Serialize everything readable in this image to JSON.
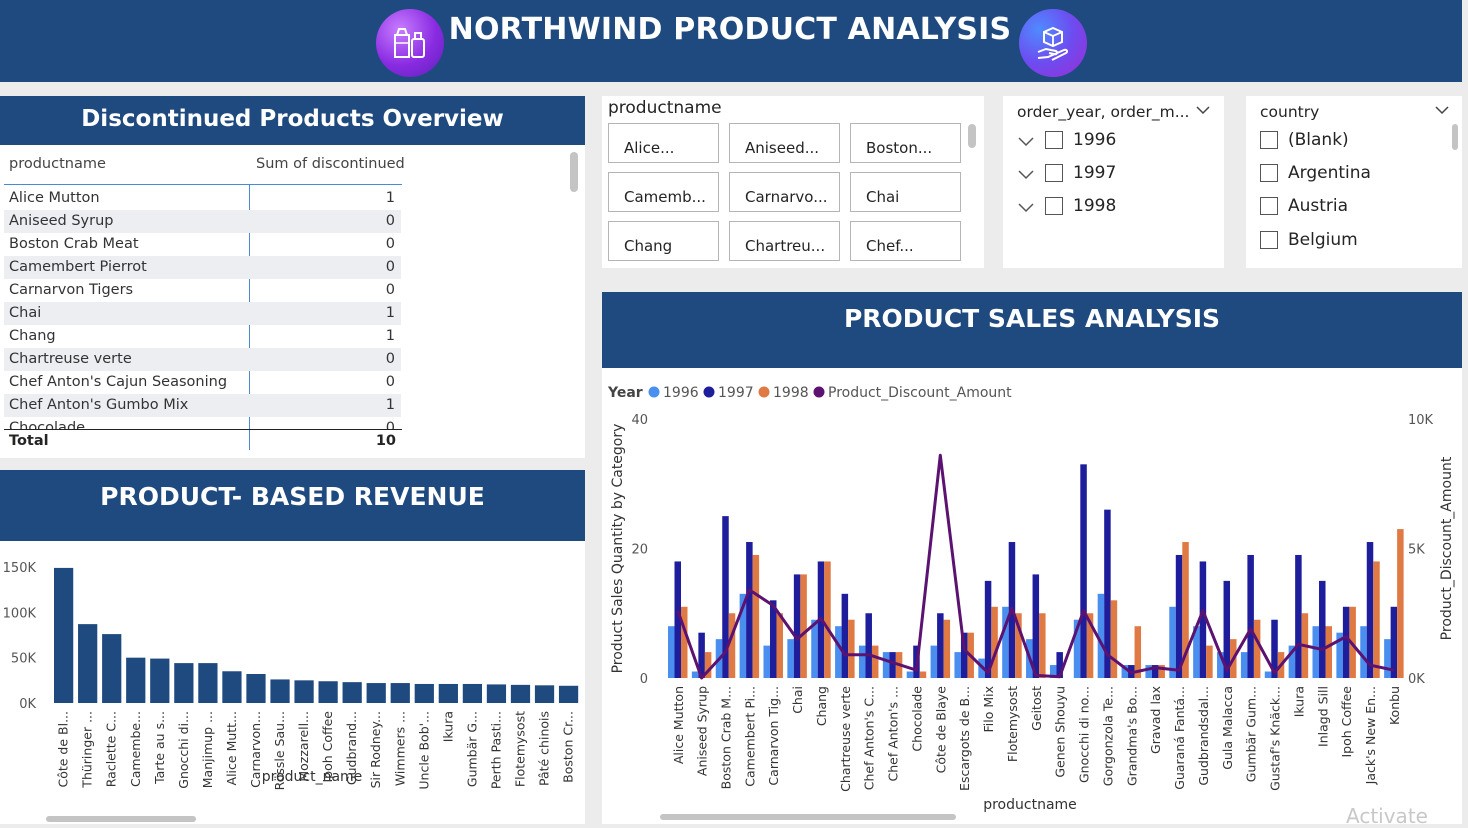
{
  "header": {
    "title": "NORTHWIND PRODUCT ANALYSIS",
    "left_icon": "milk-bottles-icon",
    "right_icon": "hand-box-icon"
  },
  "discontinued": {
    "title": "Discontinued Products Overview",
    "columns": [
      "productname",
      "Sum of discontinued"
    ],
    "rows": [
      {
        "name": "Alice Mutton",
        "value": "1"
      },
      {
        "name": "Aniseed Syrup",
        "value": "0"
      },
      {
        "name": "Boston Crab Meat",
        "value": "0"
      },
      {
        "name": "Camembert Pierrot",
        "value": "0"
      },
      {
        "name": "Carnarvon Tigers",
        "value": "0"
      },
      {
        "name": "Chai",
        "value": "1"
      },
      {
        "name": "Chang",
        "value": "1"
      },
      {
        "name": "Chartreuse verte",
        "value": "0"
      },
      {
        "name": "Chef Anton's Cajun Seasoning",
        "value": "0"
      },
      {
        "name": "Chef Anton's Gumbo Mix",
        "value": "1"
      },
      {
        "name": "Chocolade",
        "value": "0"
      }
    ],
    "total_label": "Total",
    "total_value": "10"
  },
  "product_slicer": {
    "title": "productname",
    "tiles": [
      "Alice...",
      "Aniseed...",
      "Boston...",
      "Camemb...",
      "Carnarvo...",
      "Chai",
      "Chang",
      "Chartreu...",
      "Chef..."
    ]
  },
  "year_slicer": {
    "title": "order_year, order_m...",
    "items": [
      "1996",
      "1997",
      "1998"
    ]
  },
  "country_slicer": {
    "title": "country",
    "items": [
      "(Blank)",
      "Argentina",
      "Austria",
      "Belgium"
    ]
  },
  "revenue_title": "PRODUCT- BASED REVENUE",
  "sales_title": "PRODUCT SALES ANALYSIS",
  "watermark": "Activate",
  "colors": {
    "navy": "#1f4a7f",
    "y1996": "#4a8ef0",
    "y1997": "#1e1e9c",
    "y1998": "#e07a45",
    "discount": "#5b1270",
    "revenue_bar": "#1f4a7f"
  },
  "chart_data": [
    {
      "type": "bar",
      "title": "",
      "xlabel": "product_name",
      "ylabel": "",
      "ylim": [
        0,
        150000
      ],
      "yticks": [
        "0K",
        "50K",
        "100K",
        "150K"
      ],
      "categories": [
        "Côte de Bl...",
        "Thüringer ...",
        "Raclette C...",
        "Camembe...",
        "Tarte au s...",
        "Gnocchi di...",
        "Manjimup ...",
        "Alice Mutt...",
        "Carnarvon...",
        "Rössle Sau...",
        "Mozzarell...",
        "Ipoh Coffee",
        "Gudbrand...",
        "Sir Rodney...",
        "Wimmers ...",
        "Uncle Bob'...",
        "Ikura",
        "Gumbär G...",
        "Perth Pasti...",
        "Flotemysost",
        "Pâté chinois",
        "Boston Cr..."
      ],
      "values": [
        149000,
        87000,
        76000,
        50000,
        49000,
        44000,
        44000,
        35000,
        32000,
        26000,
        25000,
        24000,
        23000,
        22000,
        22000,
        21000,
        21000,
        21000,
        20500,
        20000,
        19500,
        19000
      ]
    },
    {
      "type": "bar",
      "title": "",
      "xlabel": "productname",
      "ylabel": "Product Sales Quantity by Category",
      "y2label": "Product_Discount_Amount",
      "legend_title": "Year",
      "legend_position": "top-left",
      "ylim": [
        0,
        40
      ],
      "y2lim": [
        0,
        10000
      ],
      "yticks": [
        "0",
        "20",
        "40"
      ],
      "y2ticks": [
        "0K",
        "5K",
        "10K"
      ],
      "categories": [
        "Alice Mutton",
        "Aniseed Syrup",
        "Boston Crab M...",
        "Camembert Pi...",
        "Carnarvon Tig...",
        "Chai",
        "Chang",
        "Chartreuse verte",
        "Chef Anton's C...",
        "Chef Anton's ...",
        "Chocolade",
        "Côte de Blaye",
        "Escargots de B...",
        "Filo Mix",
        "Flotemysost",
        "Geitost",
        "Genen Shouyu",
        "Gnocchi di no...",
        "Gorgonzola Te...",
        "Grandma's Bo...",
        "Gravad lax",
        "Guaraná Fantá...",
        "Gudbrandsdal...",
        "Gula Malacca",
        "Gumbär Gum...",
        "Gustaf's Knäck...",
        "Ikura",
        "Inlagd Sill",
        "Ipoh Coffee",
        "Jack's New En...",
        "Konbu"
      ],
      "series": [
        {
          "name": "1996",
          "values": [
            8,
            1,
            6,
            13,
            5,
            6,
            9,
            8,
            5,
            4,
            1,
            5,
            4,
            3,
            11,
            6,
            2,
            9,
            13,
            2,
            2,
            11,
            8,
            4,
            4,
            1,
            5,
            8,
            7,
            8,
            6
          ]
        },
        {
          "name": "1997",
          "values": [
            18,
            7,
            25,
            21,
            12,
            16,
            18,
            13,
            10,
            4,
            5,
            10,
            7,
            15,
            21,
            16,
            4,
            33,
            26,
            2,
            2,
            19,
            18,
            15,
            19,
            9,
            19,
            15,
            11,
            21,
            11
          ]
        },
        {
          "name": "1998",
          "values": [
            11,
            4,
            10,
            19,
            10,
            16,
            18,
            9,
            5,
            4,
            1,
            9,
            7,
            11,
            10,
            10,
            0,
            10,
            12,
            8,
            2,
            21,
            5,
            6,
            9,
            4,
            10,
            8,
            11,
            18,
            23
          ]
        },
        {
          "name": "Product_Discount_Amount",
          "axis": "secondary",
          "kind": "line",
          "values": [
            2600,
            0,
            1000,
            3400,
            2800,
            1500,
            2300,
            900,
            900,
            600,
            300,
            8600,
            1100,
            200,
            2700,
            100,
            50,
            2600,
            900,
            200,
            400,
            300,
            2600,
            300,
            1900,
            200,
            1300,
            1100,
            1600,
            500,
            300
          ]
        }
      ]
    }
  ]
}
